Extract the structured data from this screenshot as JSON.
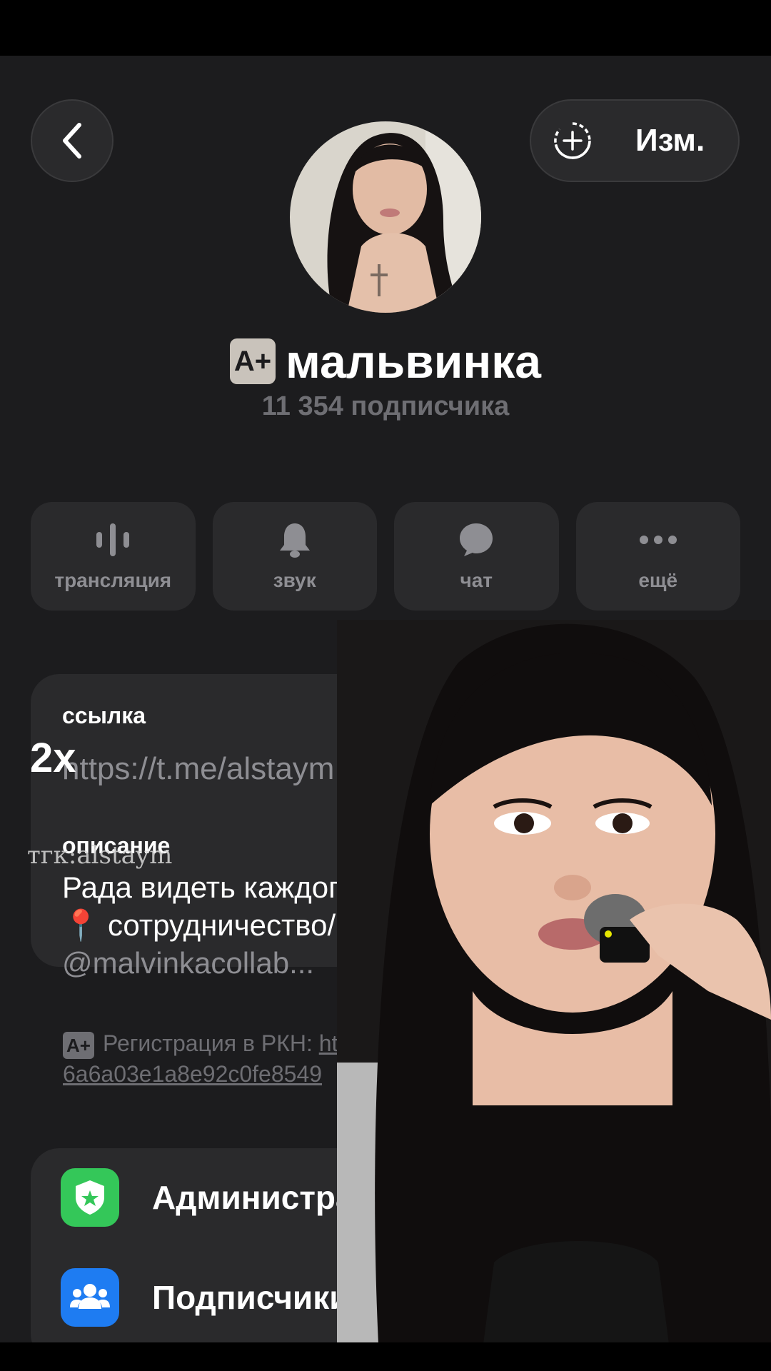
{
  "header": {
    "back_icon": "chevron-left-icon",
    "edit_icon": "add-story-icon",
    "edit_label": "Изм."
  },
  "profile": {
    "badge": "A+",
    "name": "мальвинка",
    "subscribers": "11 354 подписчика"
  },
  "actions": [
    {
      "icon": "voice-chat-icon",
      "label": "трансляция"
    },
    {
      "icon": "bell-icon",
      "label": "звук"
    },
    {
      "icon": "chat-bubble-icon",
      "label": "чат"
    },
    {
      "icon": "more-icon",
      "label": "ещё"
    }
  ],
  "info": {
    "link_label": "ссылка",
    "link_value": "https://t.me/alstaym",
    "description_label": "описание",
    "description_line1": "Рада видеть каждого у",
    "description_line2": "📍 сотрудничество/ре",
    "description_handle": "@malvinkacollab..."
  },
  "rkn": {
    "badge": "A+",
    "text": "Регистрация в РКН: ",
    "link_part1": "http",
    "link_part2": "6a6a03e1a8e92c0fe8549"
  },
  "menu": [
    {
      "icon": "shield-star-icon",
      "label": "Администра",
      "color": "#34c759"
    },
    {
      "icon": "people-icon",
      "label": "Подписчики",
      "color": "#1e7cf2"
    }
  ],
  "overlay": {
    "speed": "2x",
    "watermark": "тгк:alstaym"
  }
}
